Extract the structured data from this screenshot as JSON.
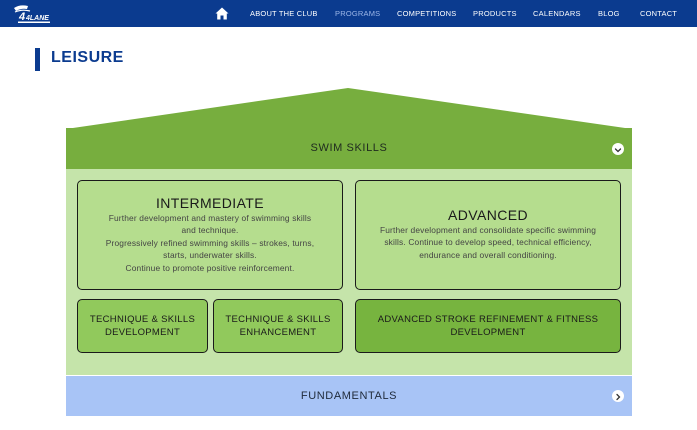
{
  "nav": {
    "home_icon": "home-icon",
    "items": [
      "ABOUT THE CLUB",
      "PROGRAMS",
      "COMPETITIONS",
      "PRODUCTS",
      "CALENDARS",
      "BLOG",
      "CONTACT"
    ]
  },
  "logo": {
    "text": "4LANE"
  },
  "page": {
    "title": "LEISURE"
  },
  "swim_skills": {
    "label": "SWIM SKILLS",
    "toggle_icon": "chevron-down-icon",
    "intermediate": {
      "title": "INTERMEDIATE",
      "lines": [
        "Further development and mastery of swimming skills",
        "and technique.",
        "Progressively refined swimming skills – strokes, turns,",
        "starts, underwater skills.",
        "Continue to promote positive reinforcement."
      ]
    },
    "advanced": {
      "title": "ADVANCED",
      "lines": [
        "Further development and consolidate specific swimming",
        "skills. Continue to develop speed, technical efficiency,",
        "endurance and overall conditioning."
      ]
    },
    "levels": [
      {
        "line1": "TECHNIQUE & SKILLS",
        "line2": "DEVELOPMENT"
      },
      {
        "line1": "TECHNIQUE & SKILLS",
        "line2": "ENHANCEMENT"
      },
      {
        "line1": "ADVANCED STROKE REFINEMENT & FITNESS",
        "line2": "DEVELOPMENT"
      }
    ]
  },
  "fundamentals": {
    "label": "FUNDAMENTALS",
    "toggle_icon": "chevron-right-icon"
  },
  "colors": {
    "nav_bg": "#0b3b8f",
    "roof_green": "#77ae3e",
    "panel_light_green": "#c5e4aa",
    "card_green": "#b5dd8e",
    "small_card_green": "#91c95c",
    "advanced_stroke_green": "#77b43f",
    "fundamentals_blue": "#a8c4f6"
  }
}
